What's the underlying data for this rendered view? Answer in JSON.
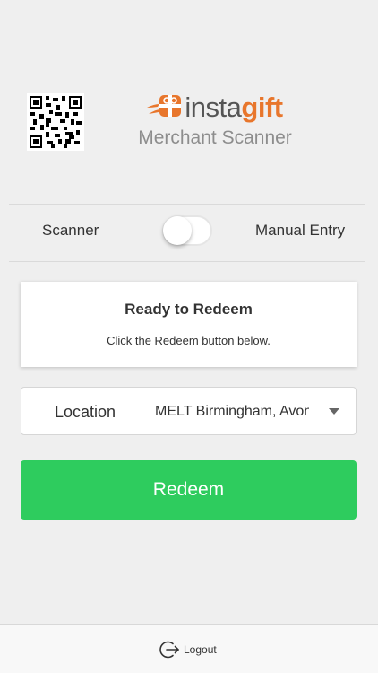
{
  "header": {
    "brand_prefix": "insta",
    "brand_suffix": "gift",
    "subtitle": "Merchant Scanner",
    "qr_icon": "qr-code-icon",
    "logo_icon": "gift-bow-icon"
  },
  "mode_toggle": {
    "left_label": "Scanner",
    "right_label": "Manual Entry",
    "state": "off"
  },
  "status": {
    "title": "Ready to Redeem",
    "message": "Click the Redeem button below."
  },
  "location": {
    "label": "Location",
    "selected": "MELT Birmingham, Avon"
  },
  "actions": {
    "redeem_label": "Redeem",
    "redeem_color": "#2ecc5e"
  },
  "footer": {
    "logout_label": "Logout",
    "logout_icon": "logout-icon"
  },
  "colors": {
    "brand_orange": "#e8762c",
    "background": "#efefef"
  }
}
